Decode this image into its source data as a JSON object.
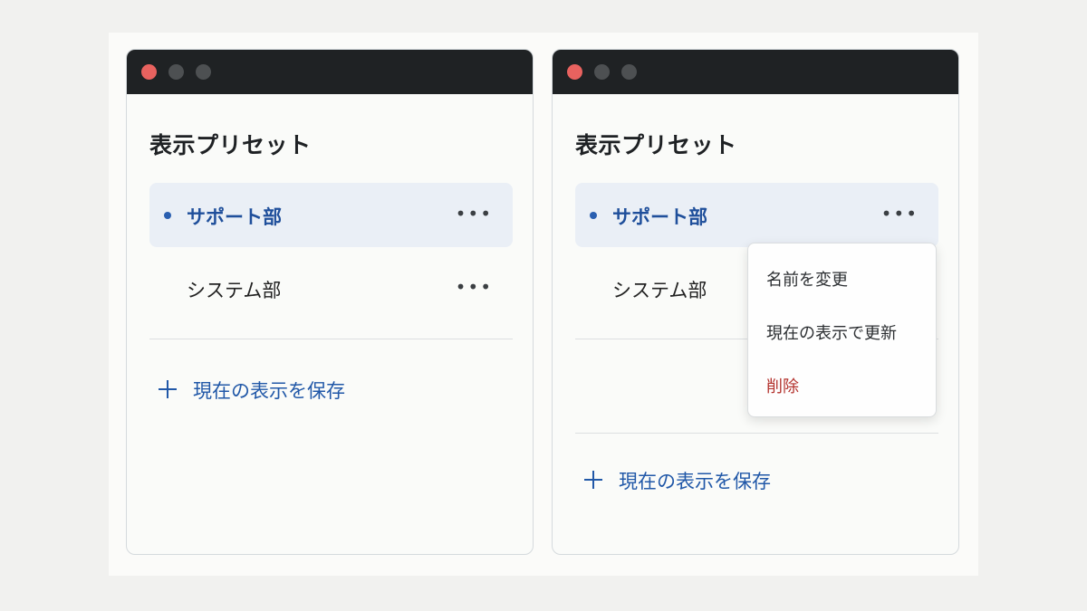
{
  "left_window": {
    "title": "表示プリセット",
    "presets": [
      {
        "label": "サポート部",
        "active": true
      },
      {
        "label": "システム部",
        "active": false
      }
    ],
    "more_label": "•••",
    "save_label": "現在の表示を保存"
  },
  "right_window": {
    "title": "表示プリセット",
    "presets": [
      {
        "label": "サポート部",
        "active": true
      },
      {
        "label": "システム部",
        "active": false
      }
    ],
    "more_label": "•••",
    "save_label": "現在の表示を保存",
    "context_menu": {
      "items": [
        {
          "label": "名前を変更"
        },
        {
          "label": "現在の表示で更新"
        },
        {
          "label": "削除",
          "danger": true
        }
      ]
    }
  },
  "colors": {
    "accent": "#2158a8",
    "active_bg": "#eaeff6",
    "danger": "#b3312c",
    "titlebar": "#1f2224"
  },
  "icons": [
    "close-dot",
    "minimize-dot",
    "zoom-dot",
    "more-icon",
    "plus-icon",
    "bullet-icon"
  ]
}
